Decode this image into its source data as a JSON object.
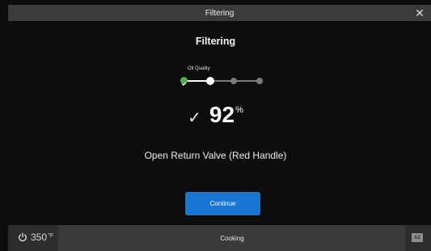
{
  "window": {
    "title": "Filtering",
    "close_icon": "close-icon"
  },
  "main": {
    "heading": "Filtering",
    "steps": {
      "label": "Oil Quality",
      "count": 4,
      "completed": 1,
      "current": 2,
      "colors": {
        "done": "#4caf50",
        "current": "#ffffff",
        "pending": "#7a7a7a"
      }
    },
    "result": {
      "check_icon": "check-icon",
      "value": "92",
      "unit": "%"
    },
    "instruction": "Open Return Valve (Red Handle)",
    "continue_label": "Continue"
  },
  "footer": {
    "power_icon": "power-icon",
    "temperature": "350",
    "temperature_unit": "°F",
    "tab_label": "Cooking",
    "language_icon": "az-keyboard-icon"
  },
  "colors": {
    "accent": "#1976d2",
    "background": "#0d0d0d",
    "titlebar": "#3b3b3b"
  }
}
